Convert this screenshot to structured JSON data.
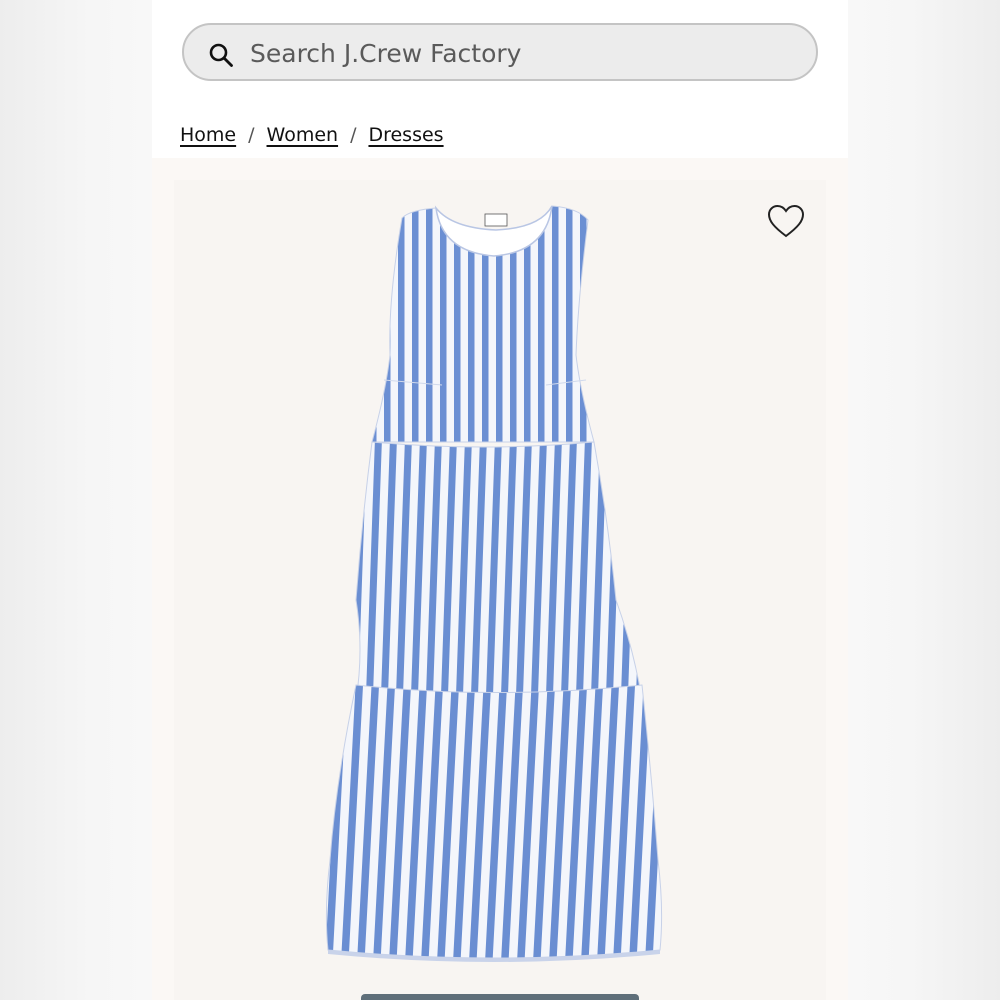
{
  "search": {
    "placeholder": "Search J.Crew Factory",
    "icon": "search-icon"
  },
  "breadcrumb": {
    "items": [
      {
        "label": "Home"
      },
      {
        "label": "Women"
      },
      {
        "label": "Dresses"
      }
    ],
    "separator": "/"
  },
  "product": {
    "image_description_icon": "dress-image",
    "wishlist_icon": "heart-outline-icon",
    "stripe_color": "#6a8fd4",
    "background_color": "#f8f5f2"
  },
  "colors": {
    "search_bg": "#ececec",
    "search_border": "#c4c4c4",
    "text": "#111111"
  }
}
